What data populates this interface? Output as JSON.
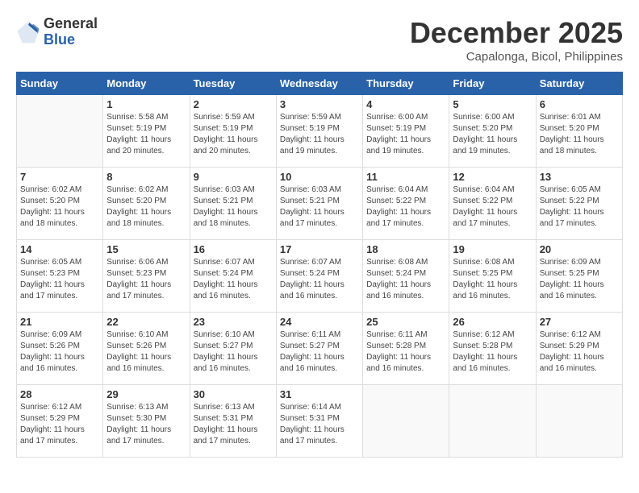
{
  "header": {
    "logo_general": "General",
    "logo_blue": "Blue",
    "month": "December 2025",
    "location": "Capalonga, Bicol, Philippines"
  },
  "weekdays": [
    "Sunday",
    "Monday",
    "Tuesday",
    "Wednesday",
    "Thursday",
    "Friday",
    "Saturday"
  ],
  "weeks": [
    [
      {
        "day": "",
        "info": ""
      },
      {
        "day": "1",
        "info": "Sunrise: 5:58 AM\nSunset: 5:19 PM\nDaylight: 11 hours\nand 20 minutes."
      },
      {
        "day": "2",
        "info": "Sunrise: 5:59 AM\nSunset: 5:19 PM\nDaylight: 11 hours\nand 20 minutes."
      },
      {
        "day": "3",
        "info": "Sunrise: 5:59 AM\nSunset: 5:19 PM\nDaylight: 11 hours\nand 19 minutes."
      },
      {
        "day": "4",
        "info": "Sunrise: 6:00 AM\nSunset: 5:19 PM\nDaylight: 11 hours\nand 19 minutes."
      },
      {
        "day": "5",
        "info": "Sunrise: 6:00 AM\nSunset: 5:20 PM\nDaylight: 11 hours\nand 19 minutes."
      },
      {
        "day": "6",
        "info": "Sunrise: 6:01 AM\nSunset: 5:20 PM\nDaylight: 11 hours\nand 18 minutes."
      }
    ],
    [
      {
        "day": "7",
        "info": "Sunrise: 6:02 AM\nSunset: 5:20 PM\nDaylight: 11 hours\nand 18 minutes."
      },
      {
        "day": "8",
        "info": "Sunrise: 6:02 AM\nSunset: 5:20 PM\nDaylight: 11 hours\nand 18 minutes."
      },
      {
        "day": "9",
        "info": "Sunrise: 6:03 AM\nSunset: 5:21 PM\nDaylight: 11 hours\nand 18 minutes."
      },
      {
        "day": "10",
        "info": "Sunrise: 6:03 AM\nSunset: 5:21 PM\nDaylight: 11 hours\nand 17 minutes."
      },
      {
        "day": "11",
        "info": "Sunrise: 6:04 AM\nSunset: 5:22 PM\nDaylight: 11 hours\nand 17 minutes."
      },
      {
        "day": "12",
        "info": "Sunrise: 6:04 AM\nSunset: 5:22 PM\nDaylight: 11 hours\nand 17 minutes."
      },
      {
        "day": "13",
        "info": "Sunrise: 6:05 AM\nSunset: 5:22 PM\nDaylight: 11 hours\nand 17 minutes."
      }
    ],
    [
      {
        "day": "14",
        "info": "Sunrise: 6:05 AM\nSunset: 5:23 PM\nDaylight: 11 hours\nand 17 minutes."
      },
      {
        "day": "15",
        "info": "Sunrise: 6:06 AM\nSunset: 5:23 PM\nDaylight: 11 hours\nand 17 minutes."
      },
      {
        "day": "16",
        "info": "Sunrise: 6:07 AM\nSunset: 5:24 PM\nDaylight: 11 hours\nand 16 minutes."
      },
      {
        "day": "17",
        "info": "Sunrise: 6:07 AM\nSunset: 5:24 PM\nDaylight: 11 hours\nand 16 minutes."
      },
      {
        "day": "18",
        "info": "Sunrise: 6:08 AM\nSunset: 5:24 PM\nDaylight: 11 hours\nand 16 minutes."
      },
      {
        "day": "19",
        "info": "Sunrise: 6:08 AM\nSunset: 5:25 PM\nDaylight: 11 hours\nand 16 minutes."
      },
      {
        "day": "20",
        "info": "Sunrise: 6:09 AM\nSunset: 5:25 PM\nDaylight: 11 hours\nand 16 minutes."
      }
    ],
    [
      {
        "day": "21",
        "info": "Sunrise: 6:09 AM\nSunset: 5:26 PM\nDaylight: 11 hours\nand 16 minutes."
      },
      {
        "day": "22",
        "info": "Sunrise: 6:10 AM\nSunset: 5:26 PM\nDaylight: 11 hours\nand 16 minutes."
      },
      {
        "day": "23",
        "info": "Sunrise: 6:10 AM\nSunset: 5:27 PM\nDaylight: 11 hours\nand 16 minutes."
      },
      {
        "day": "24",
        "info": "Sunrise: 6:11 AM\nSunset: 5:27 PM\nDaylight: 11 hours\nand 16 minutes."
      },
      {
        "day": "25",
        "info": "Sunrise: 6:11 AM\nSunset: 5:28 PM\nDaylight: 11 hours\nand 16 minutes."
      },
      {
        "day": "26",
        "info": "Sunrise: 6:12 AM\nSunset: 5:28 PM\nDaylight: 11 hours\nand 16 minutes."
      },
      {
        "day": "27",
        "info": "Sunrise: 6:12 AM\nSunset: 5:29 PM\nDaylight: 11 hours\nand 16 minutes."
      }
    ],
    [
      {
        "day": "28",
        "info": "Sunrise: 6:12 AM\nSunset: 5:29 PM\nDaylight: 11 hours\nand 17 minutes."
      },
      {
        "day": "29",
        "info": "Sunrise: 6:13 AM\nSunset: 5:30 PM\nDaylight: 11 hours\nand 17 minutes."
      },
      {
        "day": "30",
        "info": "Sunrise: 6:13 AM\nSunset: 5:31 PM\nDaylight: 11 hours\nand 17 minutes."
      },
      {
        "day": "31",
        "info": "Sunrise: 6:14 AM\nSunset: 5:31 PM\nDaylight: 11 hours\nand 17 minutes."
      },
      {
        "day": "",
        "info": ""
      },
      {
        "day": "",
        "info": ""
      },
      {
        "day": "",
        "info": ""
      }
    ]
  ]
}
